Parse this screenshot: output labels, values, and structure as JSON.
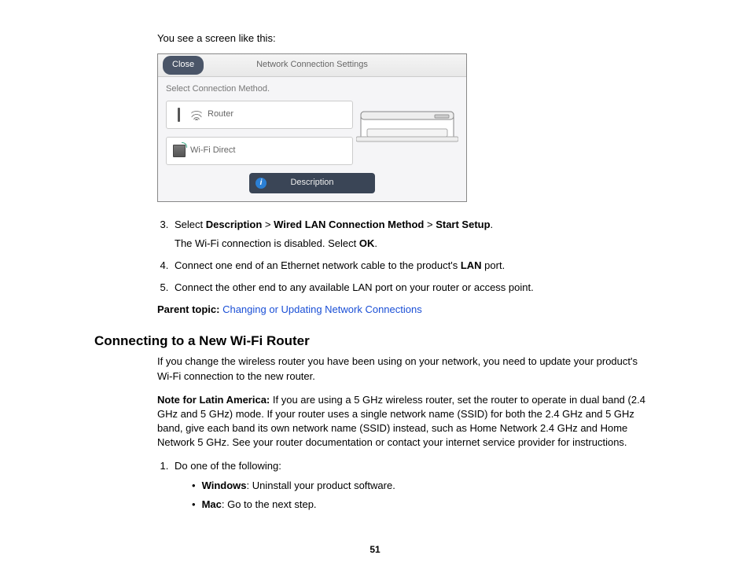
{
  "intro": "You see a screen like this:",
  "screenshot": {
    "close": "Close",
    "title": "Network Connection Settings",
    "prompt": "Select Connection Method.",
    "option_router": "Router",
    "option_wifidirect": "Wi-Fi Direct",
    "description_btn": "Description"
  },
  "step3": {
    "prefix": "Select ",
    "b1": "Description",
    "sep": " > ",
    "b2": "Wired LAN Connection Method",
    "b3": "Start Setup",
    "suffix": ".",
    "sub_a": "The Wi-Fi connection is disabled. Select ",
    "sub_b": "OK",
    "sub_c": "."
  },
  "step4": {
    "a": "Connect one end of an Ethernet network cable to the product's ",
    "b": "LAN",
    "c": " port."
  },
  "step5": "Connect the other end to any available LAN port on your router or access point.",
  "parent": {
    "label": "Parent topic: ",
    "link": "Changing or Updating Network Connections"
  },
  "heading": "Connecting to a New Wi-Fi Router",
  "para1": "If you change the wireless router you have been using on your network, you need to update your product's Wi-Fi connection to the new router.",
  "note": {
    "label": "Note for Latin America:",
    "body": " If you are using a 5 GHz wireless router, set the router to operate in dual band (2.4 GHz and 5 GHz) mode. If your router uses a single network name (SSID) for both the 2.4 GHz and 5 GHz band, give each band its own network name (SSID) instead, such as Home Network 2.4 GHz and Home Network 5 GHz. See your router documentation or contact your internet service provider for instructions."
  },
  "step_b1": "Do one of the following:",
  "bullet1": {
    "b": "Windows",
    "t": ": Uninstall your product software."
  },
  "bullet2": {
    "b": "Mac",
    "t": ": Go to the next step."
  },
  "page_number": "51"
}
